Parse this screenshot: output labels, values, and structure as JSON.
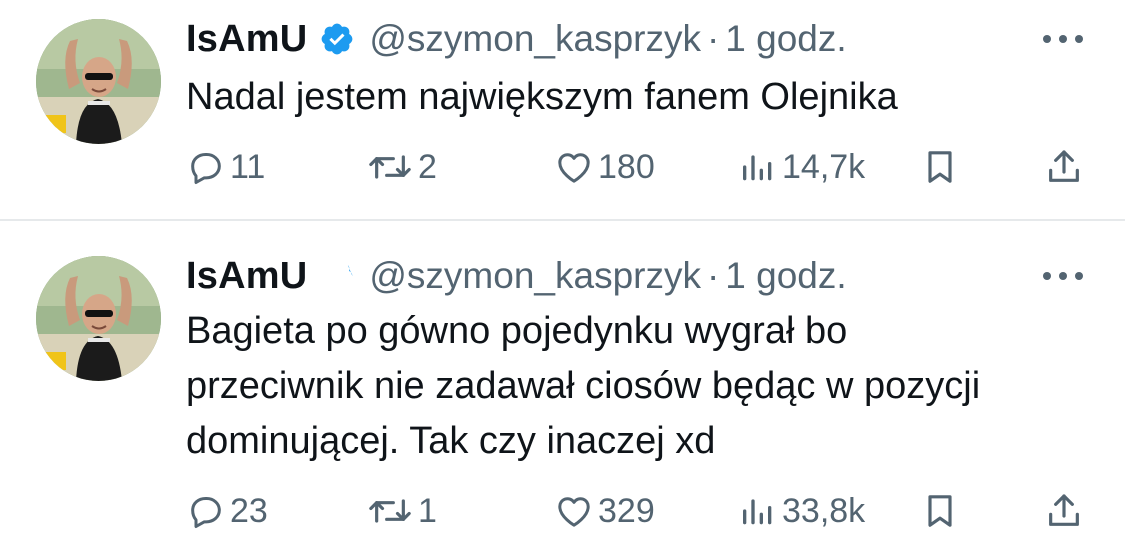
{
  "tweets": [
    {
      "author": "IsAmU",
      "handle": "@szymon_kasprzyk",
      "separator": "·",
      "time": "1 godz.",
      "text": "Nadal jestem największym fanem Olejnika",
      "stats": {
        "replies": "11",
        "retweets": "2",
        "likes": "180",
        "views": "14,7k"
      }
    },
    {
      "author": "IsAmU",
      "handle": "@szymon_kasprzyk",
      "separator": "·",
      "time": "1 godz.",
      "text": "Bagieta po gówno pojedynku wygrał bo przeciwnik nie zadawał ciosów będąc w pozycji dominującej. Tak czy inaczej xd",
      "stats": {
        "replies": "23",
        "retweets": "1",
        "likes": "329",
        "views": "33,8k"
      }
    }
  ],
  "colors": {
    "verified": "#1d9bf0",
    "muted": "#536471",
    "text": "#0f1419",
    "divider": "#e6e9eb"
  },
  "icons": [
    "verified-badge-icon",
    "more-icon",
    "reply-icon",
    "retweet-icon",
    "like-icon",
    "views-icon",
    "bookmark-icon",
    "share-icon"
  ]
}
